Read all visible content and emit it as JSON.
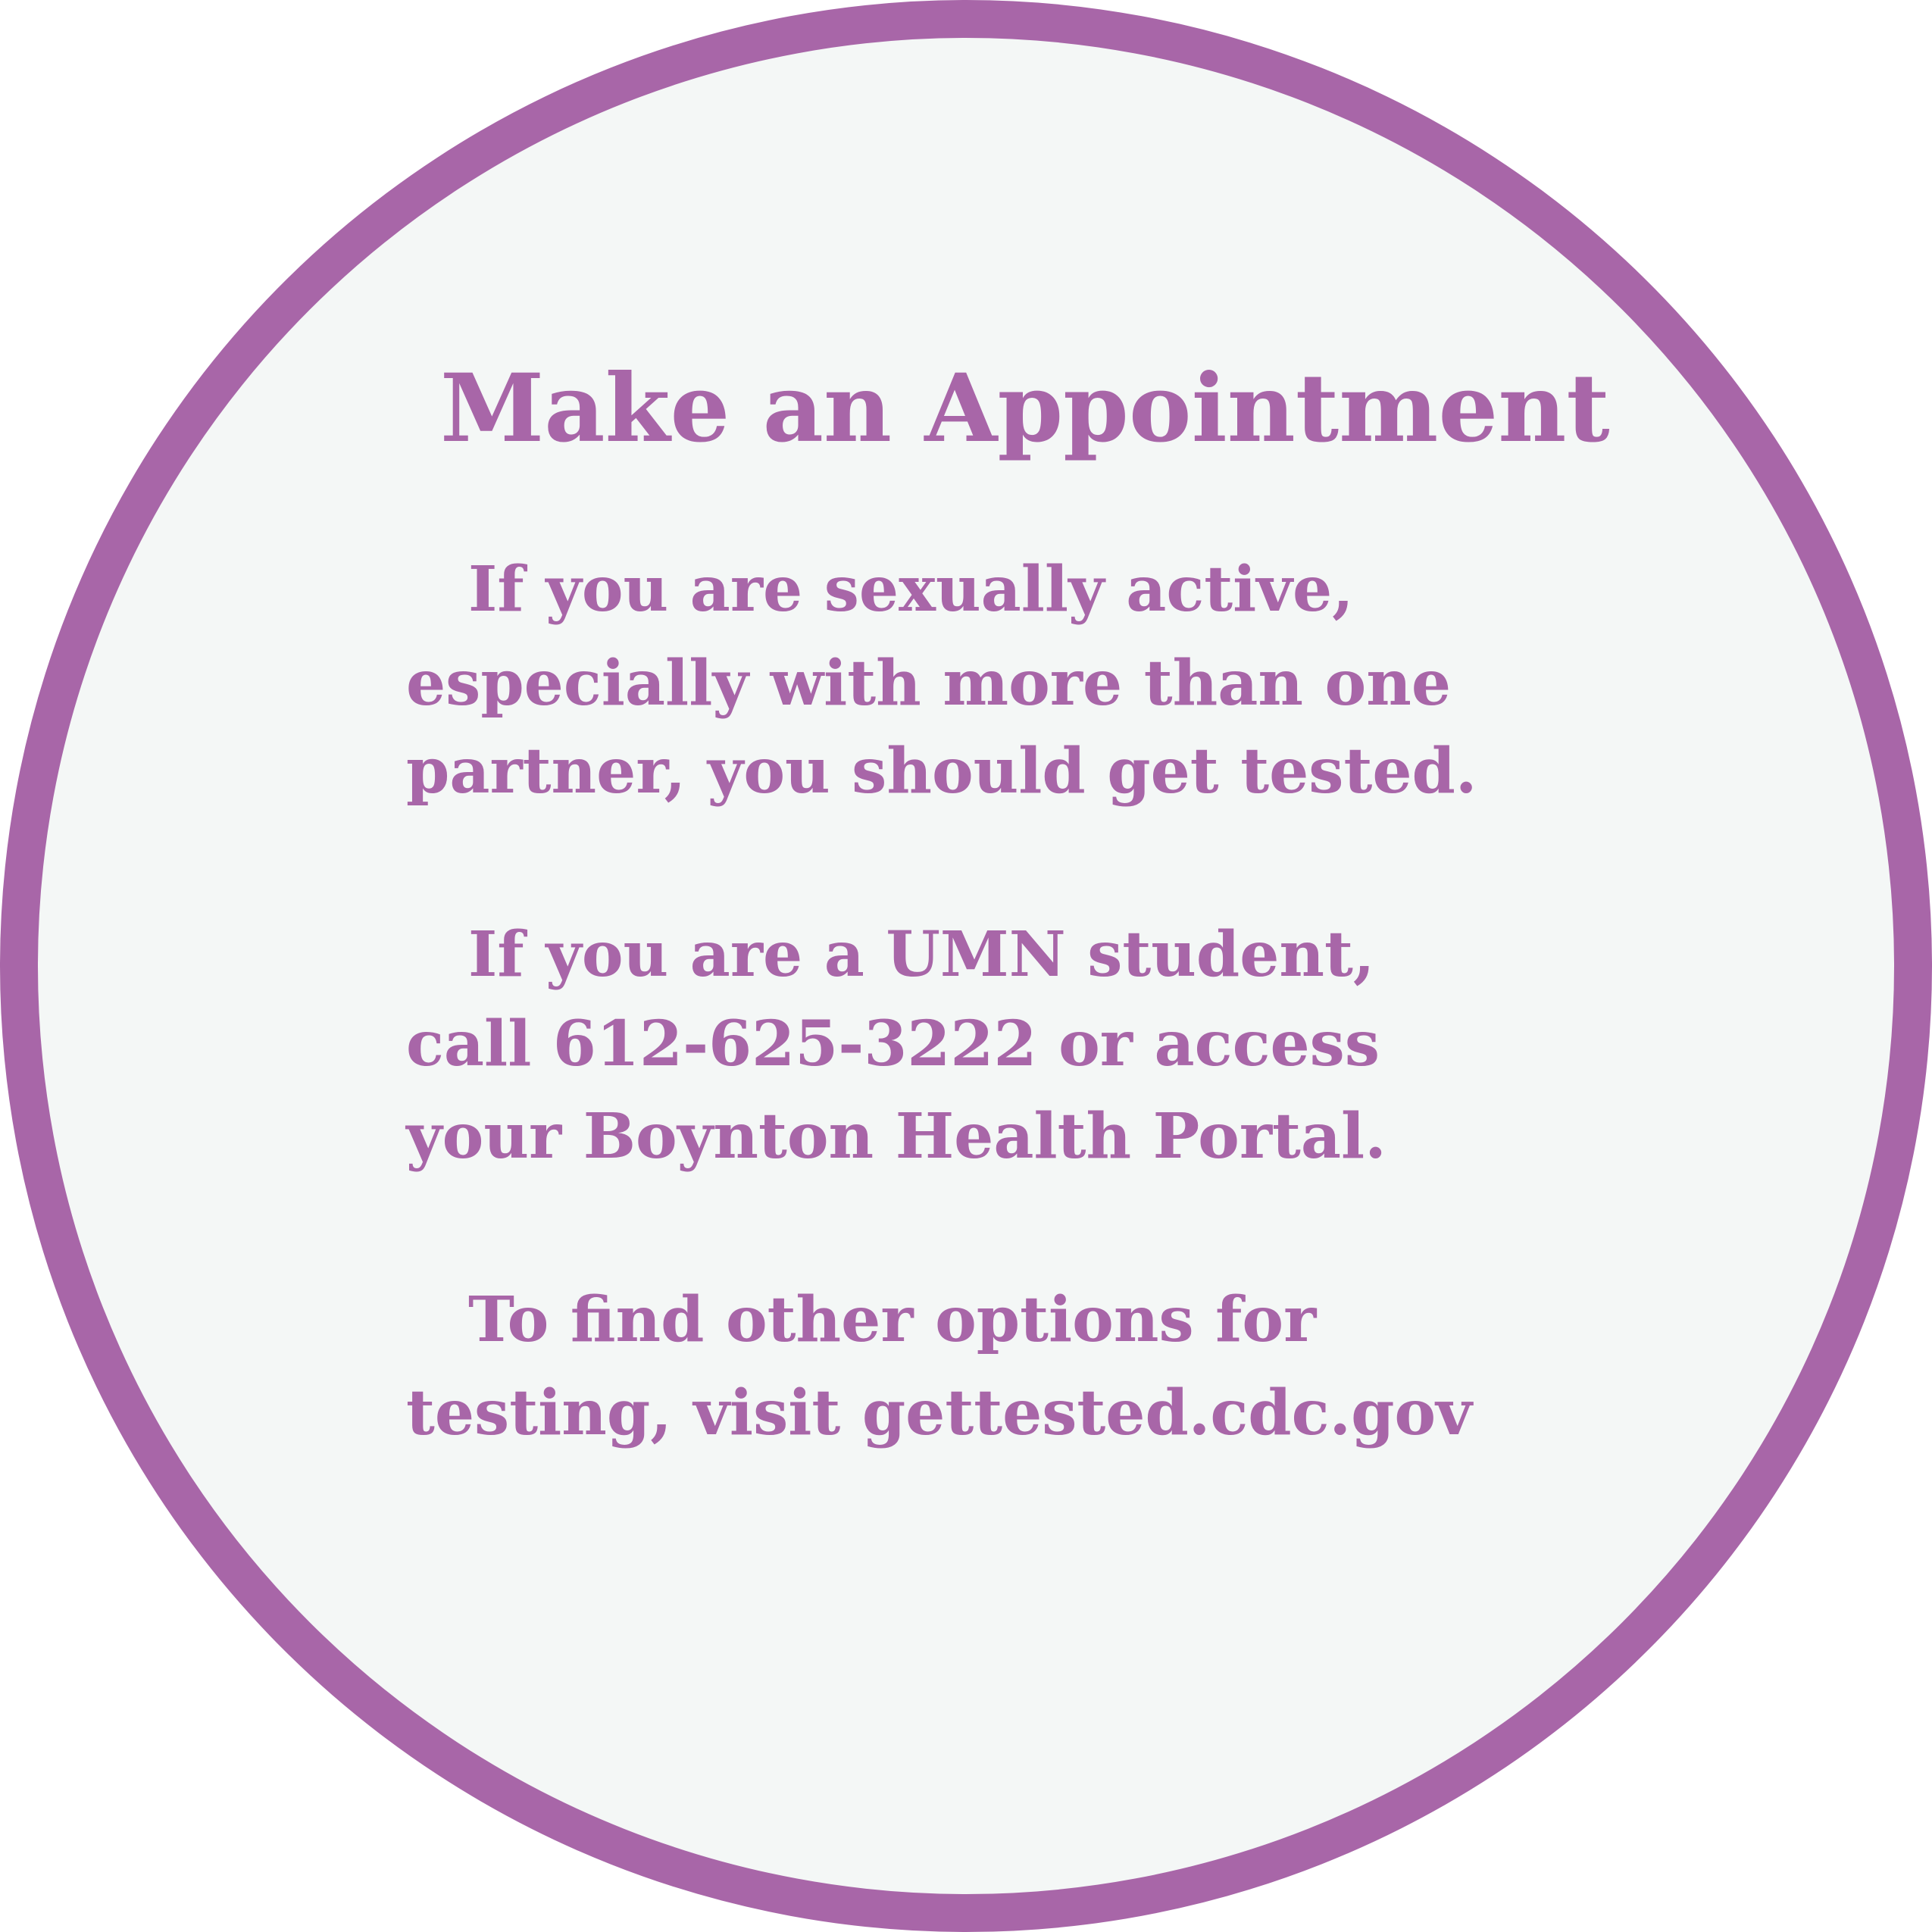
{
  "colors": {
    "accent": "#a866a8",
    "background": "#f4f7f6"
  },
  "title": "Make an Appointment",
  "paragraphs": [
    {
      "lines": [
        "If you are sexually active,",
        "especially with more than one",
        "partner, you should get tested."
      ]
    },
    {
      "lines": [
        "If you are a UMN student,",
        "call 612-625-3222 or access",
        "your Boynton Health Portal."
      ]
    },
    {
      "lines": [
        "To find other options for",
        "testing, visit gettested.cdc.gov"
      ]
    }
  ]
}
